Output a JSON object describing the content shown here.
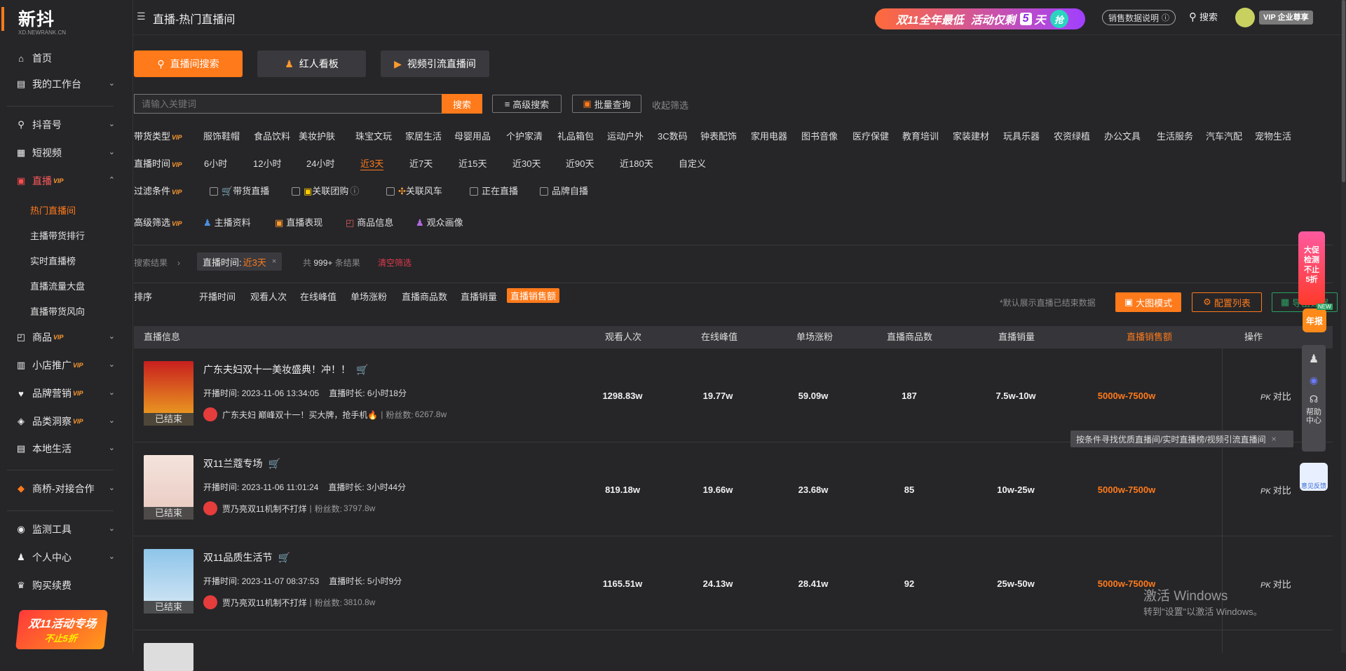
{
  "brand": {
    "name": "新抖",
    "sub": "XD.NEWRANK.CN"
  },
  "sidebar": {
    "home": "首页",
    "workbench": "我的工作台",
    "douyin": "抖音号",
    "video": "短视频",
    "live": "直播",
    "vip": "VIP",
    "live_sub": [
      "热门直播间",
      "主播带货排行",
      "实时直播榜",
      "直播流量大盘",
      "直播带货风向"
    ],
    "goods": "商品",
    "shop": "小店推广",
    "brand": "品牌营销",
    "category": "品类洞察",
    "local": "本地生活",
    "coop": "商桥-对接合作",
    "monitor": "监测工具",
    "personal": "个人中心",
    "buy": "购买续费",
    "promo": {
      "line1": "双11活动专场",
      "line2": "不止5折"
    }
  },
  "header": {
    "title": "直播-热门直播间",
    "banner": {
      "a": "双11全年最低",
      "b": "活动仅剩",
      "days": "5",
      "c": "天",
      "btn": "抢"
    },
    "sales_doc": "销售数据说明",
    "search": "搜索",
    "vip_label": "VIP 企业尊享"
  },
  "tabs": {
    "search": "直播间搜索",
    "board": "红人看板",
    "video": "视频引流直播间"
  },
  "search": {
    "placeholder": "请输入关键词",
    "btn": "搜索",
    "advanced": "高级搜索",
    "batch": "批量查询",
    "collapse": "收起筛选"
  },
  "filters": {
    "goods_type_label": "带货类型",
    "vip": "VIP",
    "goods_types": [
      "服饰鞋帽",
      "食品饮料",
      "美妆护肤",
      "珠宝文玩",
      "家居生活",
      "母婴用品",
      "个护家清",
      "礼品箱包",
      "运动户外",
      "3C数码",
      "钟表配饰",
      "家用电器",
      "图书音像",
      "医疗保健",
      "教育培训",
      "家装建材",
      "玩具乐器",
      "农资绿植",
      "办公文具",
      "生活服务",
      "汽车汽配",
      "宠物生活"
    ],
    "time_label": "直播时间",
    "times": [
      "6小时",
      "12小时",
      "24小时",
      "近3天",
      "近7天",
      "近15天",
      "近30天",
      "近90天",
      "近180天",
      "自定义"
    ],
    "cond_label": "过滤条件",
    "conds": [
      "带货直播",
      "关联团购",
      "关联风车",
      "正在直播",
      "品牌自播"
    ],
    "adv_label": "高级筛选",
    "advs": [
      "主播资料",
      "直播表现",
      "商品信息",
      "观众画像"
    ]
  },
  "result": {
    "label": "搜索结果",
    "tag_key": "直播时间:",
    "tag_val": "近3天",
    "total_pre": "共",
    "total": "999+",
    "total_post": "条结果",
    "clear": "清空筛选"
  },
  "sort": {
    "label": "排序",
    "items": [
      "开播时间",
      "观看人次",
      "在线峰值",
      "单场涨粉",
      "直播商品数",
      "直播销量",
      "直播销售额"
    ],
    "note": "*默认展示直播已结束数据",
    "big": "大图模式",
    "config": "配置列表",
    "export": "导出数据"
  },
  "table": {
    "headers": [
      "直播信息",
      "观看人次",
      "在线峰值",
      "单场涨粉",
      "直播商品数",
      "直播销量",
      "直播销售额",
      "操作"
    ],
    "rows": [
      {
        "title": "广东夫妇双十一美妆盛典！冲！！",
        "start_label": "开播时间:",
        "start": "2023-11-06 13:34:05",
        "dur_label": "直播时长:",
        "dur": "6小时18分",
        "anchor": "广东夫妇 巅峰双十一！买大牌，抢手机🔥",
        "fans_label": "粉丝数:",
        "fans": "6267.8w",
        "status": "已结束",
        "views": "1298.83w",
        "peak": "19.77w",
        "gain": "59.09w",
        "goods": "187",
        "sales": "7.5w-10w",
        "amount": "5000w-7500w",
        "op": "对比"
      },
      {
        "title": "双11兰蔻专场",
        "start_label": "开播时间:",
        "start": "2023-11-06 11:01:24",
        "dur_label": "直播时长:",
        "dur": "3小时44分",
        "anchor": "贾乃亮双11机制不打烊",
        "fans_label": "粉丝数:",
        "fans": "3797.8w",
        "status": "已结束",
        "views": "819.18w",
        "peak": "19.66w",
        "gain": "23.68w",
        "goods": "85",
        "sales": "10w-25w",
        "amount": "5000w-7500w",
        "op": "对比"
      },
      {
        "title": "双11品质生活节",
        "start_label": "开播时间:",
        "start": "2023-11-07 08:37:53",
        "dur_label": "直播时长:",
        "dur": "5小时9分",
        "anchor": "贾乃亮双11机制不打烊",
        "fans_label": "粉丝数:",
        "fans": "3810.8w",
        "status": "已结束",
        "views": "1165.51w",
        "peak": "24.13w",
        "gain": "28.41w",
        "goods": "92",
        "sales": "25w-50w",
        "amount": "5000w-7500w",
        "op": "对比"
      }
    ]
  },
  "floating": {
    "tip": "按条件寻找优质直播间/实时直播榜/视频引流直播间",
    "help": "帮助中心",
    "feedback": "意见反馈",
    "promo_a": "大促",
    "promo_b": "检测",
    "promo_c": "不止",
    "promo_d": "5折",
    "annual": "年报",
    "new": "NEW"
  },
  "watermark": {
    "line1": "激活 Windows",
    "line2": "转到\"设置\"以激活 Windows。"
  }
}
